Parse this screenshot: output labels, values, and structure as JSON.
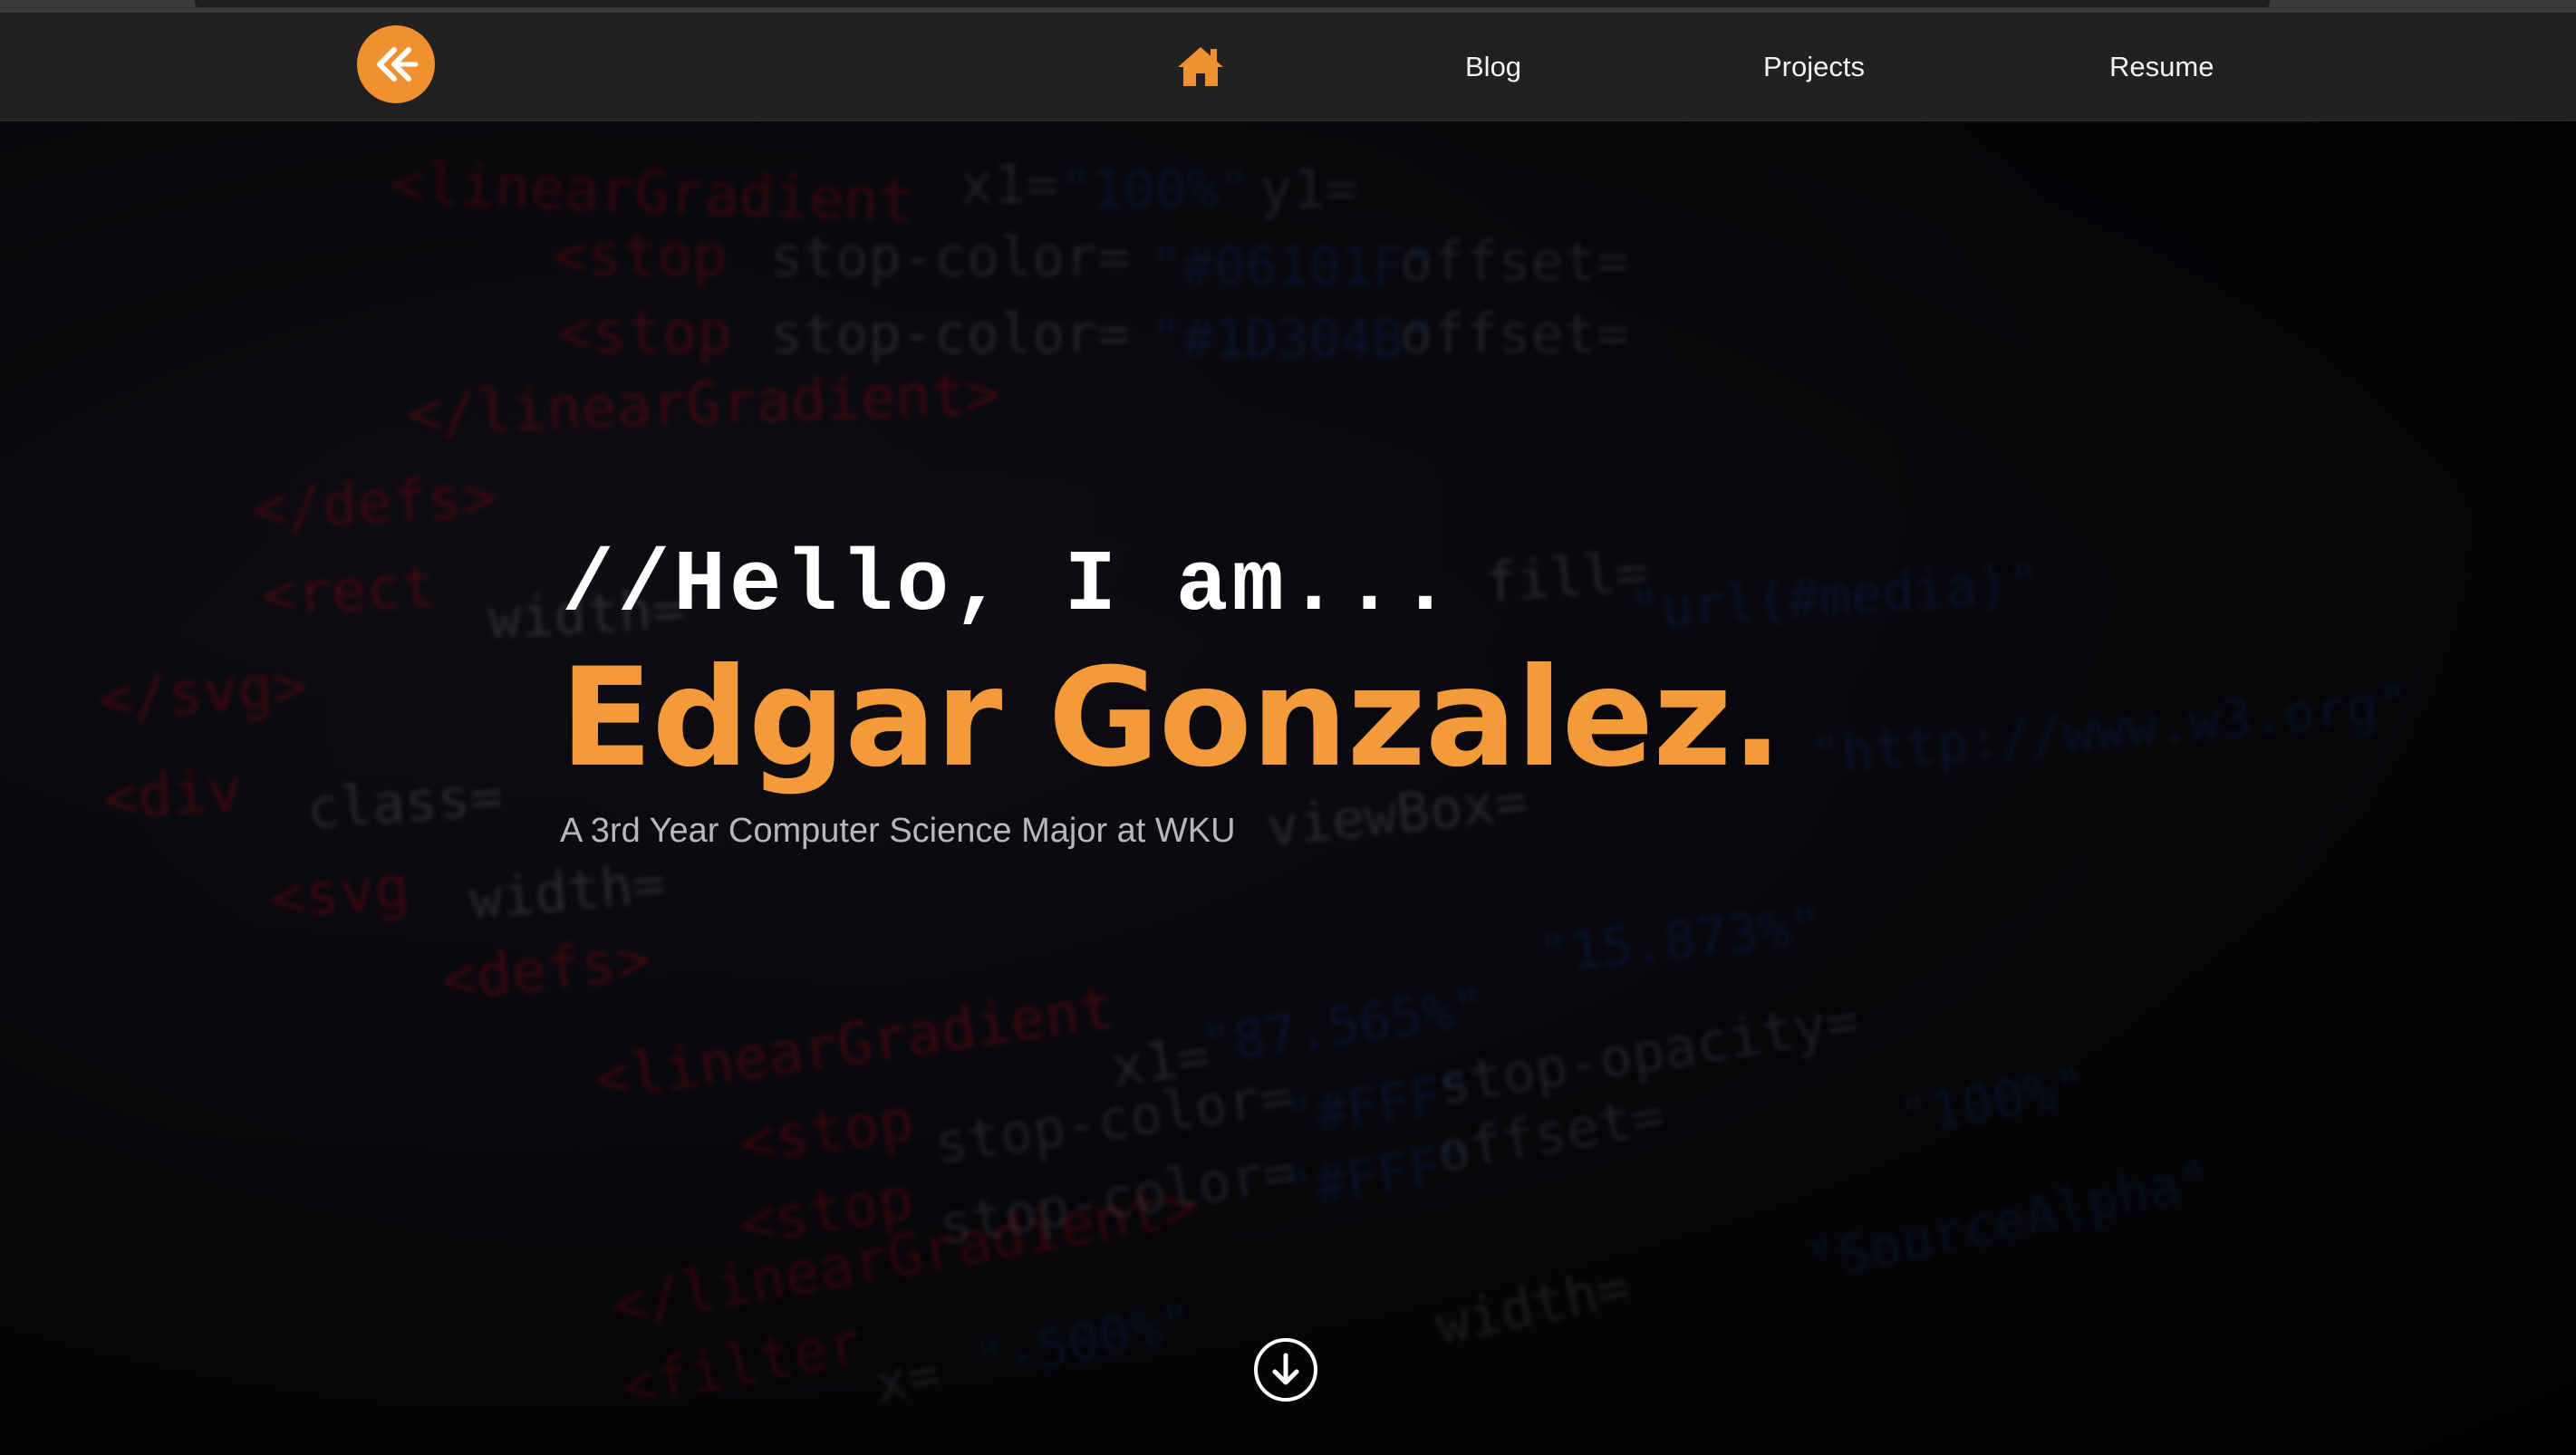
{
  "navbar": {
    "logo_icon": "double-chevron-left-icon",
    "home_icon": "home-icon",
    "links": [
      "Blog",
      "Projects",
      "Resume"
    ]
  },
  "hero": {
    "greeting": "//Hello, I am...",
    "name": "Edgar Gonzalez.",
    "subtitle": "A 3rd Year Computer Science Major at WKU",
    "scroll_icon": "arrow-down-circle-icon"
  },
  "colors": {
    "accent": "#f0902e",
    "navbar_bg": "#212123",
    "hero_bg": "#0b0b0f",
    "code_tag": "#c0102a",
    "code_attr": "#8a8a92",
    "code_value": "#1d4aa8"
  }
}
